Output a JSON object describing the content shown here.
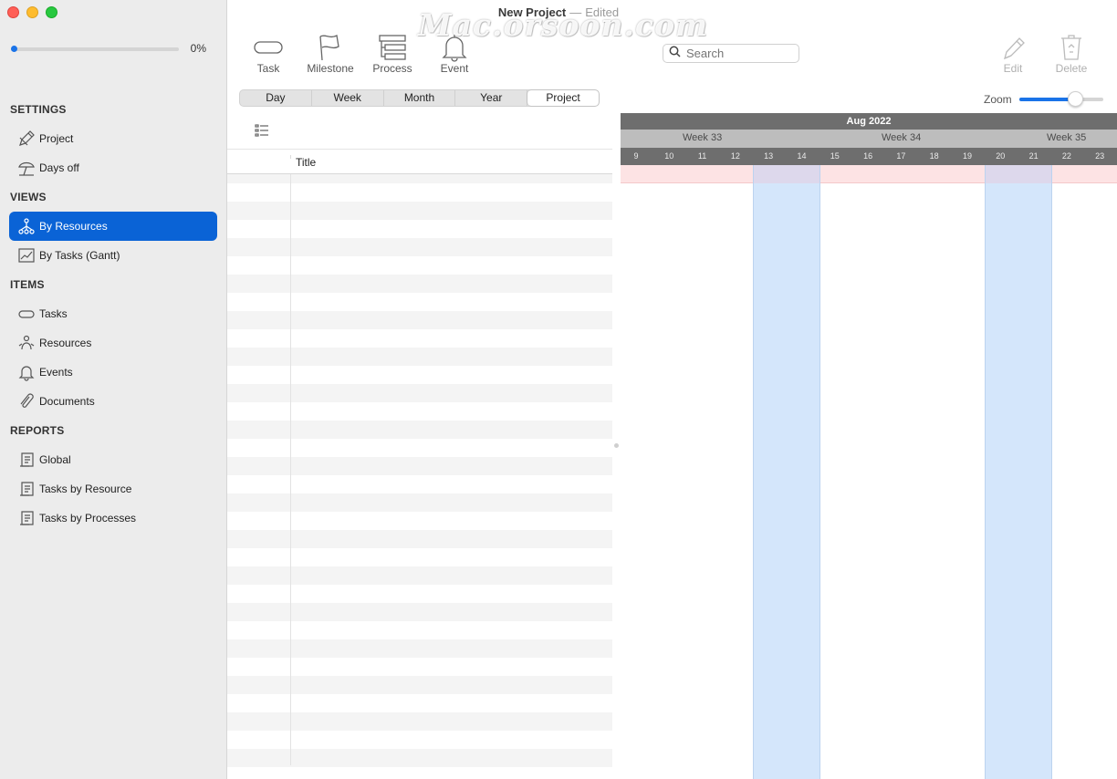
{
  "window": {
    "title": "New Project",
    "separator": "—",
    "status": "Edited",
    "watermark": "Mac.orsoon.com"
  },
  "sidebar": {
    "progress": {
      "value": 0,
      "text": "0%"
    },
    "sections": [
      {
        "heading": "SETTINGS",
        "items": [
          {
            "label": "Project",
            "icon": "pencil-ruler-icon"
          },
          {
            "label": "Days off",
            "icon": "beach-umbrella-icon"
          }
        ]
      },
      {
        "heading": "VIEWS",
        "items": [
          {
            "label": "By Resources",
            "icon": "resources-tree-icon",
            "active": true
          },
          {
            "label": "By Tasks (Gantt)",
            "icon": "gantt-chart-icon"
          }
        ]
      },
      {
        "heading": "ITEMS",
        "items": [
          {
            "label": "Tasks",
            "icon": "task-pill-icon"
          },
          {
            "label": "Resources",
            "icon": "people-icon"
          },
          {
            "label": "Events",
            "icon": "bell-icon"
          },
          {
            "label": "Documents",
            "icon": "paperclip-icon"
          }
        ]
      },
      {
        "heading": "REPORTS",
        "items": [
          {
            "label": "Global",
            "icon": "report-icon"
          },
          {
            "label": "Tasks by Resource",
            "icon": "report-icon"
          },
          {
            "label": "Tasks by Processes",
            "icon": "report-icon"
          }
        ]
      }
    ]
  },
  "toolbar": {
    "task": "Task",
    "milestone": "Milestone",
    "process": "Process",
    "event": "Event",
    "edit": "Edit",
    "delete": "Delete",
    "search_placeholder": "Search"
  },
  "views": {
    "options": [
      "Day",
      "Week",
      "Month",
      "Year",
      "Project"
    ],
    "selected": "Project"
  },
  "zoom": {
    "label": "Zoom",
    "value": 0.66
  },
  "table": {
    "columns": [
      "",
      "Title"
    ]
  },
  "gantt": {
    "month": "Aug 2022",
    "weeks": [
      "Week 33",
      "Week 34",
      "Week 35"
    ],
    "days": [
      "9",
      "10",
      "11",
      "12",
      "13",
      "14",
      "15",
      "16",
      "17",
      "18",
      "19",
      "20",
      "21",
      "22",
      "23"
    ],
    "weekend_days": [
      "13",
      "14",
      "20",
      "21"
    ]
  }
}
